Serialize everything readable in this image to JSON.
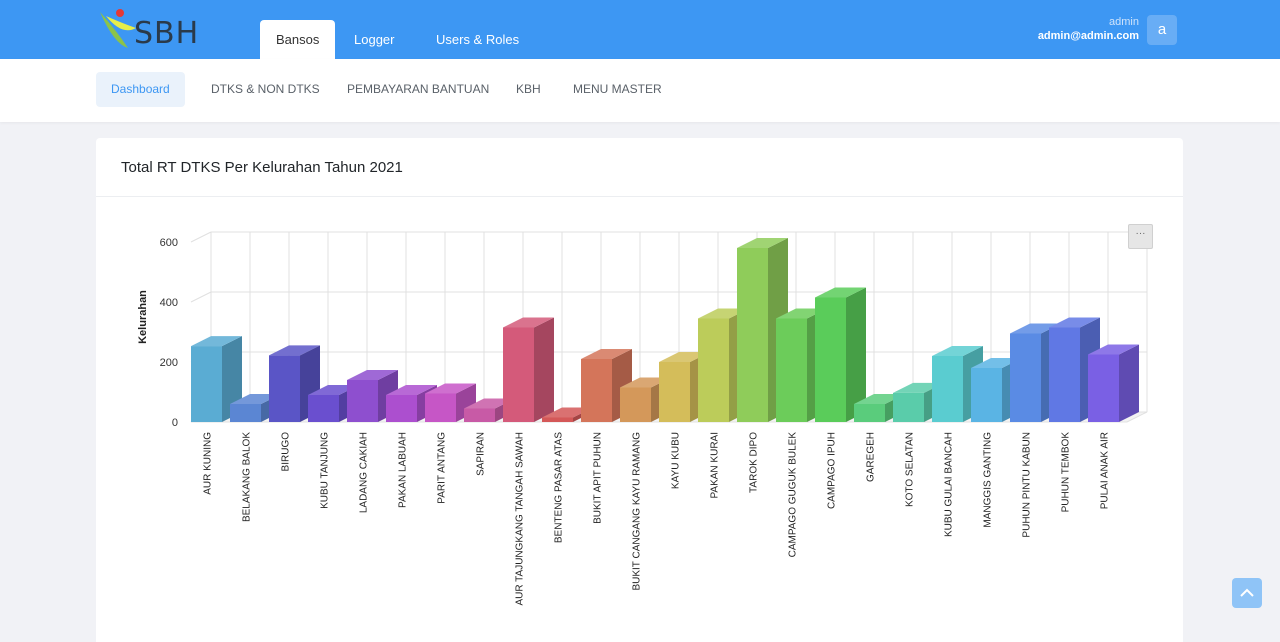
{
  "app": {
    "logo_text": "SBH"
  },
  "main_tabs": [
    {
      "label": "Bansos",
      "active": true
    },
    {
      "label": "Logger",
      "active": false
    },
    {
      "label": "Users & Roles",
      "active": false
    }
  ],
  "user": {
    "name": "admin",
    "email": "admin@admin.com",
    "avatar_letter": "a"
  },
  "sub_nav": [
    {
      "label": "Dashboard",
      "active": true
    },
    {
      "label": "DTKS & NON DTKS",
      "active": false
    },
    {
      "label": "PEMBAYARAN BANTUAN",
      "active": false
    },
    {
      "label": "KBH",
      "active": false
    },
    {
      "label": "MENU MASTER",
      "active": false
    }
  ],
  "card": {
    "title": "Total RT DTKS Per Kelurahan Tahun 2021",
    "menu_label": "···"
  },
  "icons": {
    "menu": "hamburger-menu-icon",
    "scroll_top": "chevron-up-icon"
  },
  "chart_data": {
    "type": "bar",
    "title": "",
    "xlabel": "",
    "ylabel": "Kelurahan",
    "ylim": [
      0,
      600
    ],
    "yticks": [
      0,
      200,
      400,
      600
    ],
    "categories": [
      "AUR KUNING",
      "BELAKANG BALOK",
      "BIRUGO",
      "KUBU TANJUNG",
      "LADANG CAKIAH",
      "PAKAN LABUAH",
      "PARIT ANTANG",
      "SAPIRAN",
      "AUR TAJUNGKANG TANGAH SAWAH",
      "BENTENG PASAR ATAS",
      "BUKIT APIT PUHUN",
      "BUKIT CANGANG KAYU RAMANG",
      "KAYU KUBU",
      "PAKAN KURAI",
      "TAROK DIPO",
      "CAMPAGO GUGUK BULEK",
      "CAMPAGO IPUH",
      "GAREGEH",
      "KOTO SELATAN",
      "KUBU GULAI BANCAH",
      "MANGGIS GANTING",
      "PUHUN PINTU KABUN",
      "PUHUN TEMBOK",
      "PULAI ANAK AIR"
    ],
    "values": [
      253,
      60,
      222,
      90,
      140,
      90,
      95,
      45,
      315,
      15,
      210,
      115,
      200,
      345,
      580,
      345,
      415,
      60,
      97,
      220,
      180,
      295,
      315,
      225
    ],
    "colors": [
      "#5aacd3",
      "#5b86d3",
      "#5a55c6",
      "#6a4fcf",
      "#8e4fcf",
      "#ac4fcf",
      "#c656c6",
      "#c85aa6",
      "#d45a7a",
      "#d45858",
      "#d4755a",
      "#d4985a",
      "#d4bd5a",
      "#bccc5a",
      "#8fcc5a",
      "#6ccc5a",
      "#5acc5a",
      "#5acc7c",
      "#5accaa",
      "#5accd0",
      "#5ab4e4",
      "#5a8be4",
      "#6078e4",
      "#7a60e4"
    ],
    "grid": true,
    "legend": "none"
  }
}
